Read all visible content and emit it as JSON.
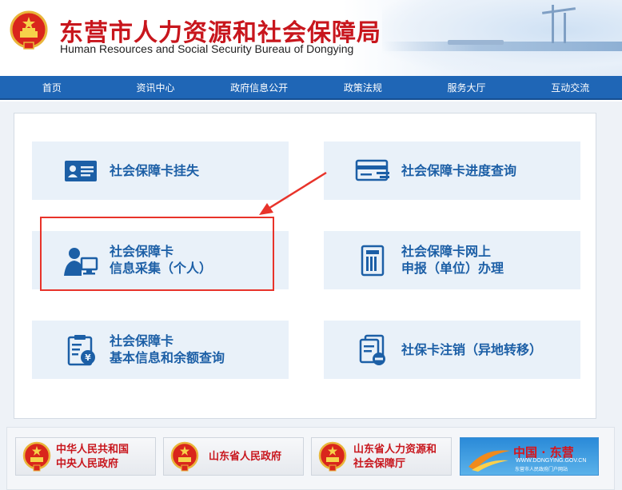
{
  "header": {
    "title_cn": "东营市人力资源和社会保障局",
    "title_en": "Human Resources and Social Security Bureau of Dongying"
  },
  "nav": {
    "items": [
      "首页",
      "资讯中心",
      "政府信息公开",
      "政策法规",
      "服务大厅",
      "互动交流"
    ]
  },
  "services": [
    {
      "line1": "社会保障卡挂失",
      "icon": "id-card-icon"
    },
    {
      "line1": "社会保障卡进度查询",
      "icon": "card-progress-icon"
    },
    {
      "line1": "社会保障卡",
      "line2": "信息采集（个人）",
      "icon": "person-computer-icon"
    },
    {
      "line1": "社会保障卡网上",
      "line2": "申报（单位）办理",
      "icon": "document-binder-icon"
    },
    {
      "line1": "社会保障卡",
      "line2": "基本信息和余额查询",
      "icon": "clipboard-yen-icon"
    },
    {
      "line1": "社保卡注销（异地转移）",
      "icon": "document-cancel-icon"
    }
  ],
  "footer": {
    "links": [
      {
        "line1": "中华人民共和国",
        "line2": "中央人民政府"
      },
      {
        "line1": "山东省人民政府"
      },
      {
        "line1": "山东省人力资源和",
        "line2": "社会保障厅"
      }
    ],
    "portal": {
      "title": "中国 · 东营",
      "url": "WWW.DONGYING.GOV.CN",
      "subtitle": "东营市人民政府门户网站"
    }
  },
  "colors": {
    "nav_bg": "#1f66b6",
    "title_red": "#c8161d",
    "tile_bg": "#e9f1f9",
    "tile_text": "#1c5fa6",
    "highlight": "#e8332a"
  }
}
